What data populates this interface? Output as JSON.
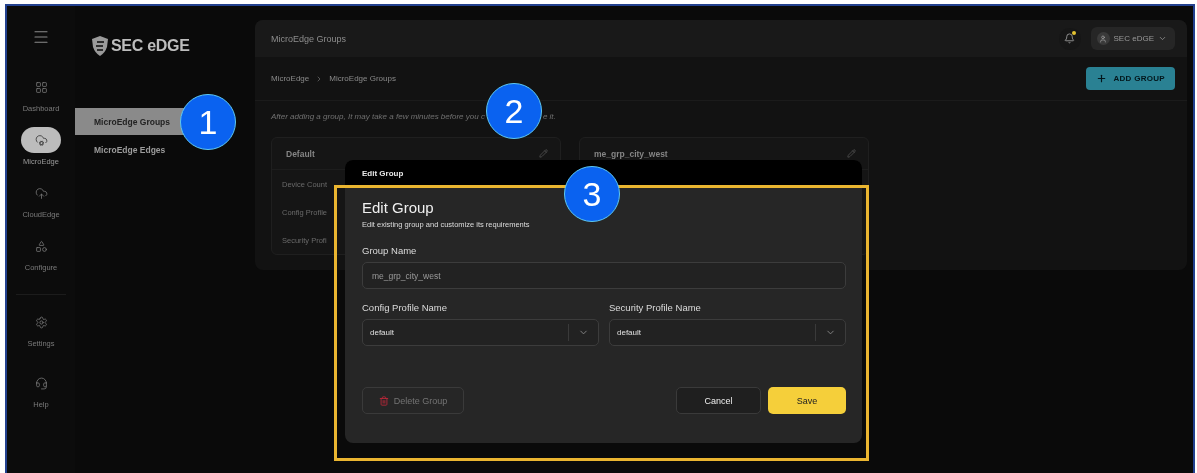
{
  "rail": {
    "items": [
      {
        "label": "Dashboard",
        "selected": false
      },
      {
        "label": "MicroEdge",
        "selected": true
      },
      {
        "label": "CloudEdge",
        "selected": false
      },
      {
        "label": "Configure",
        "selected": false
      }
    ],
    "bottom_items": [
      {
        "label": "Settings",
        "selected": false
      },
      {
        "label": "Help",
        "selected": false
      }
    ]
  },
  "logo": {
    "text": "SEC eDGE"
  },
  "sidebar": {
    "items": [
      {
        "label": "MicroEdge Groups",
        "selected": true
      },
      {
        "label": "MicroEdge Edges",
        "selected": false
      }
    ]
  },
  "header": {
    "title": "MicroEdge Groups",
    "unread": true,
    "user": "SEC eDGE"
  },
  "breadcrumb": [
    "MicroEdge",
    "MicroEdge Groups"
  ],
  "add_button": "ADD GROUP",
  "notice": [
    "After adding a group, It may take a few minutes before you c",
    "e it."
  ],
  "cards": [
    {
      "title": "Default",
      "rows": [
        "Device Count",
        "Config Profile",
        "Security Profi"
      ]
    },
    {
      "title": "me_grp_city_west"
    }
  ],
  "dialog": {
    "caption": "Edit Group",
    "title": "Edit Group",
    "subtitle": "Edit existing group and customize its requirements",
    "fields": [
      {
        "kind": "text",
        "label": "Group Name",
        "value": "me_grp_city_west"
      },
      {
        "kind": "select",
        "label": "Config Profile Name",
        "value": "default"
      },
      {
        "kind": "select",
        "label": "Security Profile Name",
        "value": "default"
      }
    ],
    "buttons": [
      {
        "kind": "danger",
        "label": "Delete Group",
        "disabled": true
      },
      {
        "kind": "secondary",
        "label": "Cancel",
        "disabled": false
      },
      {
        "kind": "primary",
        "label": "Save",
        "disabled": false
      }
    ]
  },
  "annotations": [
    {
      "label": "1"
    },
    {
      "label": "2"
    },
    {
      "label": "3"
    }
  ]
}
